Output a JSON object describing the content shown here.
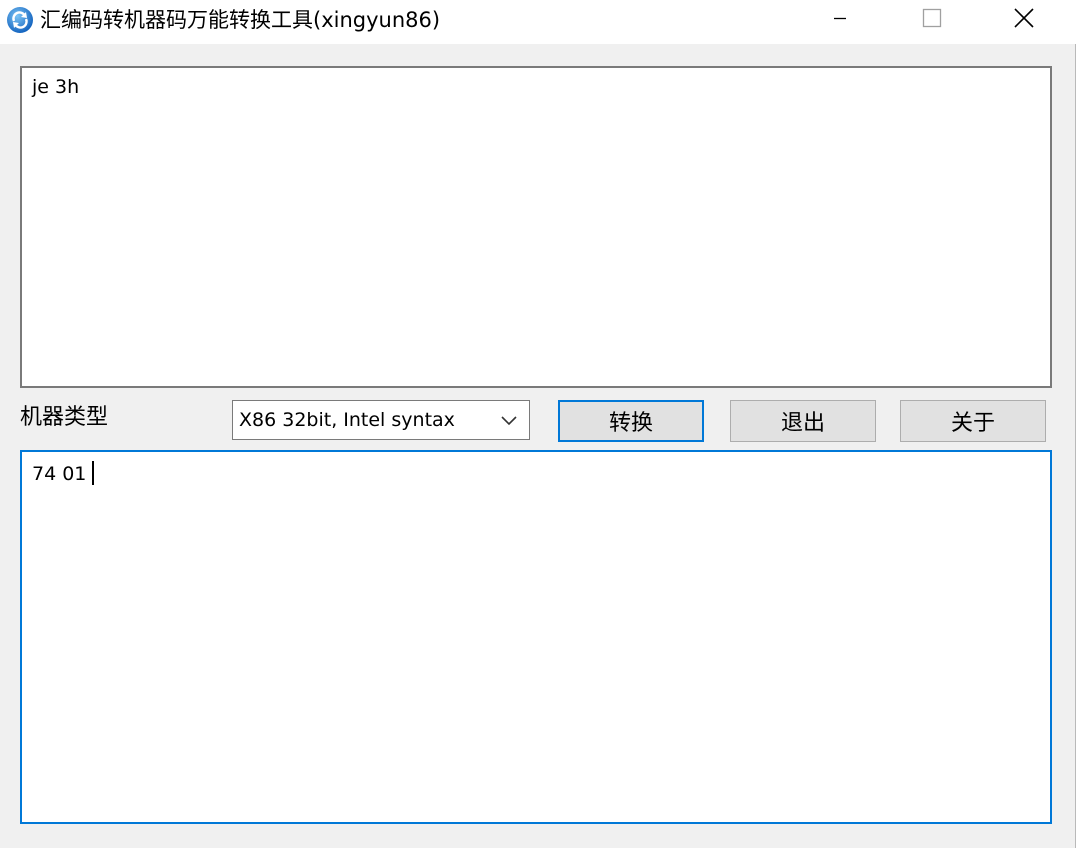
{
  "window": {
    "title": "汇编码转机器码万能转换工具(xingyun86)"
  },
  "input": {
    "value": "je 3h"
  },
  "machine_type": {
    "label": "机器类型",
    "selected": "X86 32bit, Intel syntax"
  },
  "buttons": {
    "convert": "转换",
    "exit": "退出",
    "about": "关于"
  },
  "output": {
    "value": "74 01"
  },
  "colors": {
    "accent": "#0078d7",
    "background": "#f0f0f0"
  },
  "icons": {
    "app": "refresh-globe-icon",
    "minimize": "minimize-icon",
    "maximize": "maximize-icon",
    "close": "close-icon",
    "dropdown": "chevron-down-icon"
  }
}
